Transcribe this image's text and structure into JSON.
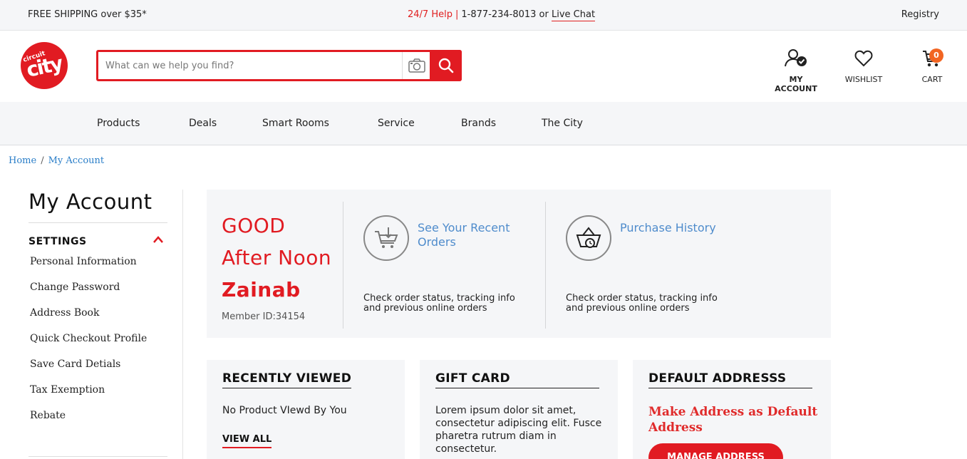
{
  "topbar": {
    "shipping": "FREE SHIPPING over $35*",
    "help_label": "24/7 Help",
    "help_sep": "|",
    "phone": "1-877-234-8013 or",
    "live_chat": "Live Chat",
    "registry": "Registry"
  },
  "brand": {
    "small": "circuit",
    "big": "city"
  },
  "search": {
    "placeholder": "What can we help you find?"
  },
  "header_icons": {
    "account": "MY ACCOUNT",
    "wishlist": "WISHLIST",
    "cart": "CART",
    "cart_count": "0"
  },
  "nav": [
    "Products",
    "Deals",
    "Smart Rooms",
    "Service",
    "Brands",
    "The City"
  ],
  "breadcrumb": {
    "home": "Home",
    "sep": "/",
    "current": "My Account"
  },
  "sidebar": {
    "title": "My Account",
    "section": "SETTINGS",
    "items": [
      "Personal Information",
      "Change Password",
      "Address Book",
      "Quick Checkout Profile",
      "Save Card Detials",
      "Tax Exemption",
      "Rebate"
    ]
  },
  "greeting": {
    "line1": "GOOD",
    "line2": "After Noon",
    "name": "Zainab",
    "member_id": "Member ID:34154"
  },
  "quick_links": [
    {
      "title": "See Your Recent Orders",
      "desc": "Check order status, tracking info and previous online orders",
      "icon": "cart-icon"
    },
    {
      "title": "Purchase History",
      "desc": "Check order status, tracking info and previous online orders",
      "icon": "basket-clock-icon"
    }
  ],
  "cards": {
    "recent": {
      "title": "RECENTLY VIEWED",
      "text": "No Product VIewd By You",
      "link": "VIEW ALL"
    },
    "gift": {
      "title": "GIFT CARD",
      "text": "Lorem ipsum dolor sit amet, consectetur adipiscing elit. Fusce pharetra rutrum diam in consectetur."
    },
    "address": {
      "title": "DEFAULT ADDRESSS",
      "text": "Make Address as Default Address",
      "button": "MANAGE ADDRESS"
    }
  },
  "colors": {
    "brand_red": "#e11b22",
    "link_blue": "#4f8ccc",
    "badge_orange": "#f26522"
  }
}
